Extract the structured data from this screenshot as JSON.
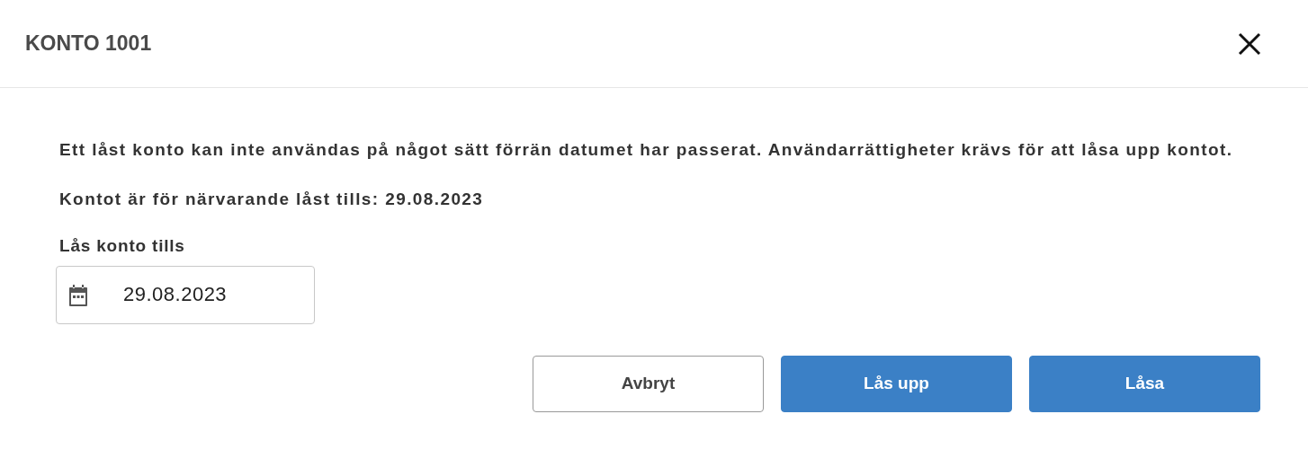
{
  "dialog": {
    "title": "KONTO 1001",
    "paragraphs": [
      "Ett låst konto kan inte användas på något sätt förrän datumet har passerat. Användarrättigheter krävs för att låsa upp kontot.",
      "Kontot är för närvarande låst tills: 29.08.2023"
    ],
    "date_field": {
      "label": "Lås konto tills",
      "value": "29.08.2023"
    },
    "buttons": [
      {
        "label": "Avbryt",
        "kind": "secondary"
      },
      {
        "label": "Lås upp",
        "kind": "primary"
      },
      {
        "label": "Låsa",
        "kind": "primary"
      }
    ]
  }
}
